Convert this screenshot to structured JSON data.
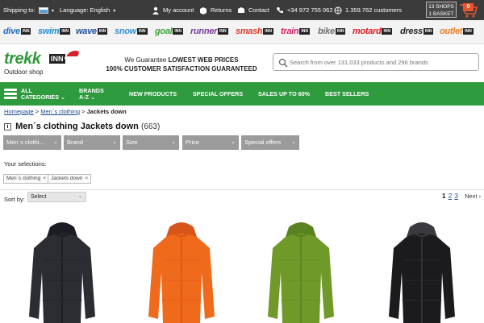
{
  "topbar": {
    "shipping_label": "Shipping to:",
    "language_label": "Language: English",
    "my_account": "My account",
    "returns": "Returns",
    "contact": "Contact",
    "phone": "+34 972 755 062",
    "customers": "1.359.762 customers",
    "shops": "13 SHOPS",
    "basket": "1 BASKET",
    "cart_count": "0"
  },
  "brands": [
    {
      "name": "dive",
      "color": "#1f6fc0"
    },
    {
      "name": "swim",
      "color": "#1a8fd6"
    },
    {
      "name": "wave",
      "color": "#1b4f9e"
    },
    {
      "name": "snow",
      "color": "#2f8fd4"
    },
    {
      "name": "goal",
      "color": "#3aa335"
    },
    {
      "name": "runner",
      "color": "#7a3b9e"
    },
    {
      "name": "smash",
      "color": "#e23a2a"
    },
    {
      "name": "train",
      "color": "#d6226b"
    },
    {
      "name": "bike",
      "color": "#6e6e6e"
    },
    {
      "name": "motard",
      "color": "#d81f26"
    },
    {
      "name": "dress",
      "color": "#222222"
    },
    {
      "name": "outlet",
      "color": "#f07a1a"
    }
  ],
  "brand_suffix": "INN",
  "header": {
    "logo": "trekk",
    "logo_inn": "INN",
    "logo_sub": "Outdoor shop",
    "guarantee_line1_prefix": "We Guarantee ",
    "guarantee_line1_bold": "LOWEST WEB PRICES",
    "guarantee_line2": "100% CUSTOMER SATISFACTION GUARANTEED",
    "search_placeholder": "Search from over 131.033 products and 296 brands"
  },
  "nav": {
    "all": "ALL",
    "categories": "CATEGORIES",
    "brands": "BRANDS",
    "brands_sub": "A-Z",
    "new_products": "NEW PRODUCTS",
    "special_offers": "SPECIAL OFFERS",
    "sales": "SALES UP TO 60%",
    "best_sellers": "BEST SELLERS"
  },
  "breadcrumb": {
    "home": "Homepage",
    "sep": ">",
    "mens": "Men´s clothing",
    "current": "Jackets down"
  },
  "page": {
    "title": "Men´s clothing Jackets down",
    "count": "(663)"
  },
  "filters": [
    "Men´s clothi...",
    "Brand",
    "Size",
    "Price",
    "Special offers"
  ],
  "selections_label": "Your selections:",
  "chips": [
    "Men´s clothing",
    "Jackets down"
  ],
  "chip_x": "×",
  "sort": {
    "label": "Sort by:",
    "value": "Select"
  },
  "pager": {
    "p1": "1",
    "p2": "2",
    "p3": "3",
    "next": "Next"
  },
  "products": [
    {
      "color": "#2b2d33",
      "trim": "#1c1d22"
    },
    {
      "color": "#f06a1c",
      "trim": "#d8551a"
    },
    {
      "color": "#6f9a2a",
      "trim": "#5a8220"
    },
    {
      "color": "#1b1b1d",
      "trim": "#3a3a3e"
    }
  ],
  "colors": {
    "topbar": "#3b3b3b",
    "nav_green": "#2e9b3e",
    "filter_gray": "#9b9b9b",
    "cart_badge": "#e8542b"
  }
}
